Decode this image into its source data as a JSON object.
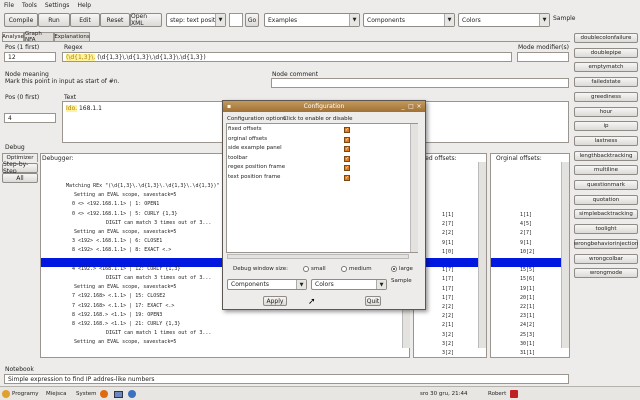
{
  "menu": [
    "File",
    "Tools",
    "Settings",
    "Help"
  ],
  "toolbar": {
    "compile": "Compile",
    "run": "Run",
    "edit": "Edit",
    "reset": "Reset",
    "open_xml": "Open XML",
    "step_combo": "step: text position",
    "go": "Go",
    "examples": "Examples",
    "components": "Components",
    "colors": "Colors",
    "sample": "Sample"
  },
  "tabs": [
    "Analyse",
    "Graph NFA",
    "Explanations"
  ],
  "pos_first": {
    "label": "Pos (1 first)",
    "value": "12"
  },
  "regex": {
    "label": "Regex",
    "value": "(\\d{1,3}\\.\\d{1,3}\\.\\d{1,3}\\.\\d{1,3})",
    "prefix": "(\\d{1,3}\\."
  },
  "modifiers": {
    "label": "Mode modifier(s)"
  },
  "node_meaning": {
    "label": "Node meaning",
    "value": "Mark this point in input as start of #n."
  },
  "node_comment": {
    "label": "Node comment"
  },
  "pos_zero": {
    "label": "Pos (0 first)",
    "value": "4"
  },
  "text": {
    "label": "Text",
    "value": "168.1.1",
    "prefix": "Ido."
  },
  "debug": {
    "label": "Debug",
    "optimizer": "Optimizer",
    "step_by_step": "Step-by-Step",
    "all": "All",
    "debugger_label": "Debugger:",
    "lines": [
      "Matching REx \"(\\d{1,3}\\.\\d{1,3}\\.\\d{1,3}\\.\\d{1,3})\" against",
      "Setting an EVAL scope, savestack=5",
      "0 <> <192.168.1.1>   |  1:  OPEN1",
      "0 <> <192.168.1.1>   |  5:  CURLY {1,3}",
      "DIGIT can match 3 times out of 3...",
      "Setting an EVAL scope, savestack=5",
      "3 <192> <.168.1.1>   |  6:  CLOSE1",
      "8 <192> <.168.1.1>   |  8:  EXACT <.>",
      "",
      "4 <192.> <168.1.1>   | 12:  CURLY {1,3}",
      "DIGIT can match 3 times out of 3...",
      "Setting an EVAL scope, savestack=5",
      "7 <192.168> <.1.1>   | 15:  CLOSE2",
      "7 <192.168> <.1.1>   | 17:  EXACT <.>",
      "8 <192.168.> <1.1>   | 19:  OPEN3",
      "8 <192.168.> <1.1>   | 21:  CURLY {1,3}",
      "DIGIT can match 1 times out of 3...",
      "Setting an EVAL scope, savestack=5"
    ]
  },
  "fixed_offsets": {
    "label": "fixed offsets:",
    "rows": [
      "1[1]",
      "2[7]",
      "2[2]",
      "9[1]",
      "1[0]",
      "",
      "1[7]",
      "1[7]",
      "1[7]",
      "1[7]",
      "2[2]",
      "2[2]",
      "2[1]",
      "3[2]",
      "3[2]",
      "3[2]"
    ]
  },
  "original_offsets": {
    "label": "Orginal offsets:",
    "rows": [
      "1[1]",
      "4[5]",
      "2[7]",
      "9[1]",
      "10[2]",
      "",
      "15[5]",
      "15[6]",
      "19[1]",
      "20[1]",
      "22[1]",
      "23[1]",
      "24[2]",
      "25[3]",
      "30[1]",
      "31[1]"
    ]
  },
  "sidebar": [
    "doublecolonfailure",
    "doublepipe",
    "emptymatch",
    "failedstate",
    "greediness",
    "hour",
    "ip",
    "lastness",
    "lengthbacktracking",
    "multiline",
    "questionmark",
    "quotation",
    "simplebacktracking",
    "toolight",
    "wrongbehaviorinjection",
    "wrongcolbar",
    "wrongmode"
  ],
  "notebook": {
    "label": "Notebook",
    "value": "Simple expression to find IP addres-like numbers"
  },
  "dialog": {
    "title": "Configuration",
    "col1": "Configuration options",
    "col2": "Click to enable or disable",
    "options": [
      "fixed offsets",
      "orginal offsets",
      "side example panel",
      "toolbar",
      "regex position frame",
      "text position frame"
    ],
    "window_size_label": "Debug window size:",
    "sizes": [
      "small",
      "medium",
      "large"
    ],
    "selected_size": "large",
    "combo1": "Components",
    "combo2": "Colors",
    "sample": "Sample",
    "apply": "Apply",
    "quit": "Quit"
  },
  "taskbar": {
    "programs": "Programy",
    "places": "Miejsca",
    "system": "System",
    "datetime": "sro 30 gru, 21:44",
    "user": "Robert"
  },
  "colors": {
    "highlight": "#0018e0",
    "titlebar": "#b0803e",
    "checkbox": "#e07a22"
  }
}
